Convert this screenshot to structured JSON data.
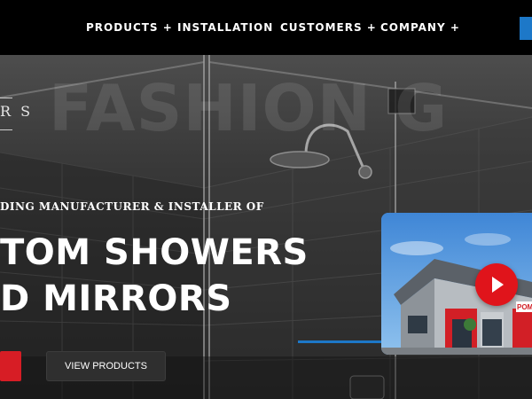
{
  "nav": {
    "items": [
      "PRODUCTS +",
      "INSTALLATION",
      "CUSTOMERS +",
      "COMPANY +"
    ]
  },
  "hero": {
    "background_word": "FASHION G",
    "logo_text": "R S",
    "tagline": "DING MANUFACTURER & INSTALLER OF",
    "headline_line1": "TOM SHOWERS",
    "headline_line2": "D MIRRORS",
    "primary_button_label": "",
    "secondary_button_label": "VIEW PRODUCTS"
  },
  "video": {
    "storefront_sign": "POM"
  },
  "colors": {
    "nav_background": "#000000",
    "accent_blue": "#1d78c8",
    "brand_red": "#d71d25",
    "play_red": "#e0141b"
  },
  "icons": {
    "play": "play-icon"
  }
}
